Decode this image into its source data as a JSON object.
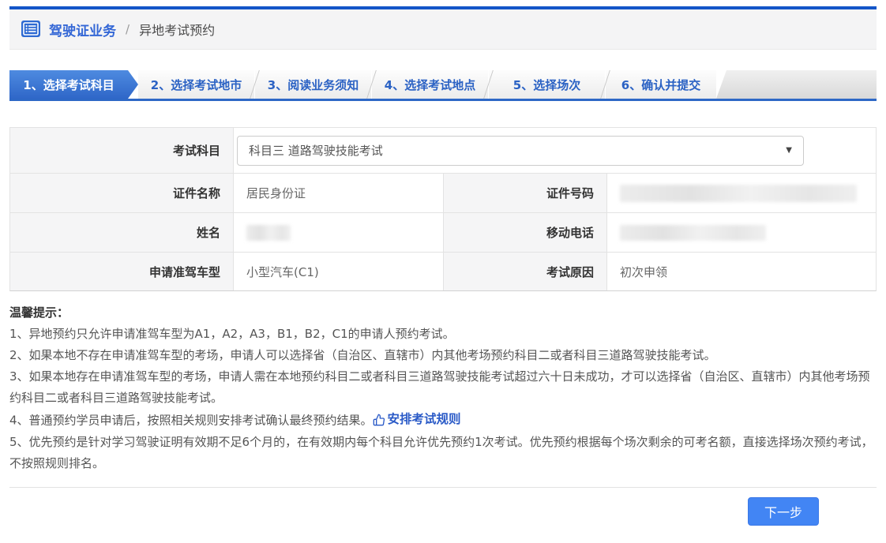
{
  "breadcrumb": {
    "section": "驾驶证业务",
    "separator": "/",
    "page": "异地考试预约"
  },
  "steps": [
    {
      "label": "1、选择考试科目",
      "active": true
    },
    {
      "label": "2、选择考试地市",
      "active": false
    },
    {
      "label": "3、阅读业务须知",
      "active": false
    },
    {
      "label": "4、选择考试地点",
      "active": false
    },
    {
      "label": "5、选择场次",
      "active": false
    },
    {
      "label": "6、确认并提交",
      "active": false
    }
  ],
  "form": {
    "exam_subject": {
      "label": "考试科目",
      "value": "科目三 道路驾驶技能考试"
    },
    "id_type": {
      "label": "证件名称",
      "value": "居民身份证"
    },
    "id_number": {
      "label": "证件号码",
      "redacted": true
    },
    "name": {
      "label": "姓名",
      "redacted": true
    },
    "mobile": {
      "label": "移动电话",
      "redacted": true
    },
    "vehicle_type": {
      "label": "申请准驾车型",
      "value": "小型汽车(C1)"
    },
    "exam_reason": {
      "label": "考试原因",
      "value": "初次申领"
    }
  },
  "tips": {
    "title": "温馨提示：",
    "item1": "1、异地预约只允许申请准驾车型为A1，A2，A3，B1，B2，C1的申请人预约考试。",
    "item2": "2、如果本地不存在申请准驾车型的考场，申请人可以选择省（自治区、直辖市）内其他考场预约科目二或者科目三道路驾驶技能考试。",
    "item3": "3、如果本地存在申请准驾车型的考场，申请人需在本地预约科目二或者科目三道路驾驶技能考试超过六十日未成功，才可以选择省（自治区、直辖市）内其他考场预约科目二或者科目三道路驾驶技能考试。",
    "item4_text": "4、普通预约学员申请后，按照相关规则安排考试确认最终预约结果。",
    "item4_link": "安排考试规则",
    "item5": "5、优先预约是针对学习驾驶证明有效期不足6个月的，在有效期内每个科目允许优先预约1次考试。优先预约根据每个场次剩余的可考名额，直接选择场次预约考试，不按照规则排名。"
  },
  "footer": {
    "next_button": "下一步"
  },
  "icons": {
    "breadcrumb_icon": "list-icon",
    "select_caret": "▼",
    "rules_link_icon": "thumbs-up-icon"
  },
  "colors": {
    "top_border": "#1355c8",
    "accent_blue": "#2f6bd2",
    "active_tab_top": "#4e8be0",
    "active_tab_bottom": "#2f67c8",
    "tab_text_blue": "#2b62c4",
    "button_blue": "#4285f4",
    "link_blue": "#2a5ac7",
    "label_cell_bg": "#f5f5f6"
  }
}
